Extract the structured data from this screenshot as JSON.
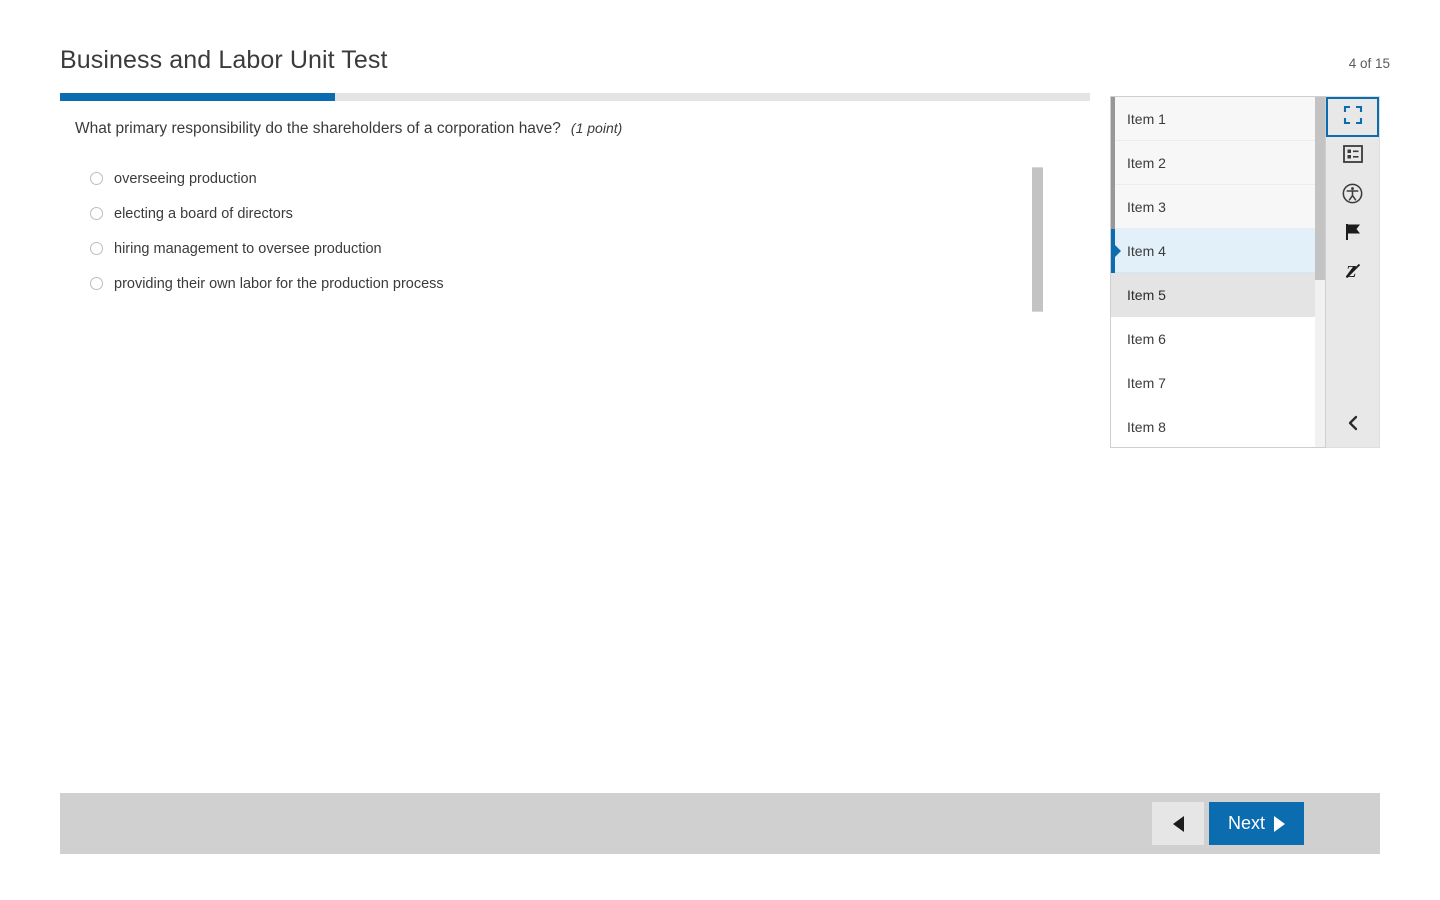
{
  "header": {
    "title": "Business and Labor Unit Test",
    "counter": "4 of 15"
  },
  "progress": {
    "percent": 26.7,
    "fill_color": "#0b6cb0",
    "track_color": "#e4e4e4"
  },
  "question": {
    "stem": "What primary responsibility do the shareholders of a corporation have?",
    "points": "(1 point)",
    "choices": [
      {
        "label": "overseeing production",
        "selected": false
      },
      {
        "label": "electing a board of directors",
        "selected": false
      },
      {
        "label": "hiring management to oversee production",
        "selected": false
      },
      {
        "label": "providing their own labor for the production process",
        "selected": false
      }
    ]
  },
  "nav_panel": {
    "items": [
      {
        "label": "Item 1",
        "state": "answered"
      },
      {
        "label": "Item 2",
        "state": "answered"
      },
      {
        "label": "Item 3",
        "state": "answered"
      },
      {
        "label": "Item 4",
        "state": "current"
      },
      {
        "label": "Item 5",
        "state": "hovered"
      },
      {
        "label": "Item 6",
        "state": "default"
      },
      {
        "label": "Item 7",
        "state": "default"
      },
      {
        "label": "Item 8",
        "state": "default"
      }
    ]
  },
  "tools": [
    {
      "icon": "fullscreen-icon",
      "name": "fullscreen",
      "selected": true
    },
    {
      "icon": "item-list-icon",
      "name": "item-list",
      "selected": false
    },
    {
      "icon": "accessibility-icon",
      "name": "accessibility",
      "selected": false
    },
    {
      "icon": "flag-icon",
      "name": "flag",
      "selected": false
    },
    {
      "icon": "eliminate-choice-icon",
      "name": "eliminate-choice",
      "selected": false
    }
  ],
  "footer": {
    "previous_label": "",
    "next_label": "Next",
    "next_color": "#0b6cb0"
  },
  "colors": {
    "accent": "#0b6cb0",
    "current_item_bg": "#e2f0fa",
    "hover_item_bg": "#e4e4e4",
    "answered_item_bg": "#f7f7f7",
    "footer_bg": "#d0d0d0"
  }
}
